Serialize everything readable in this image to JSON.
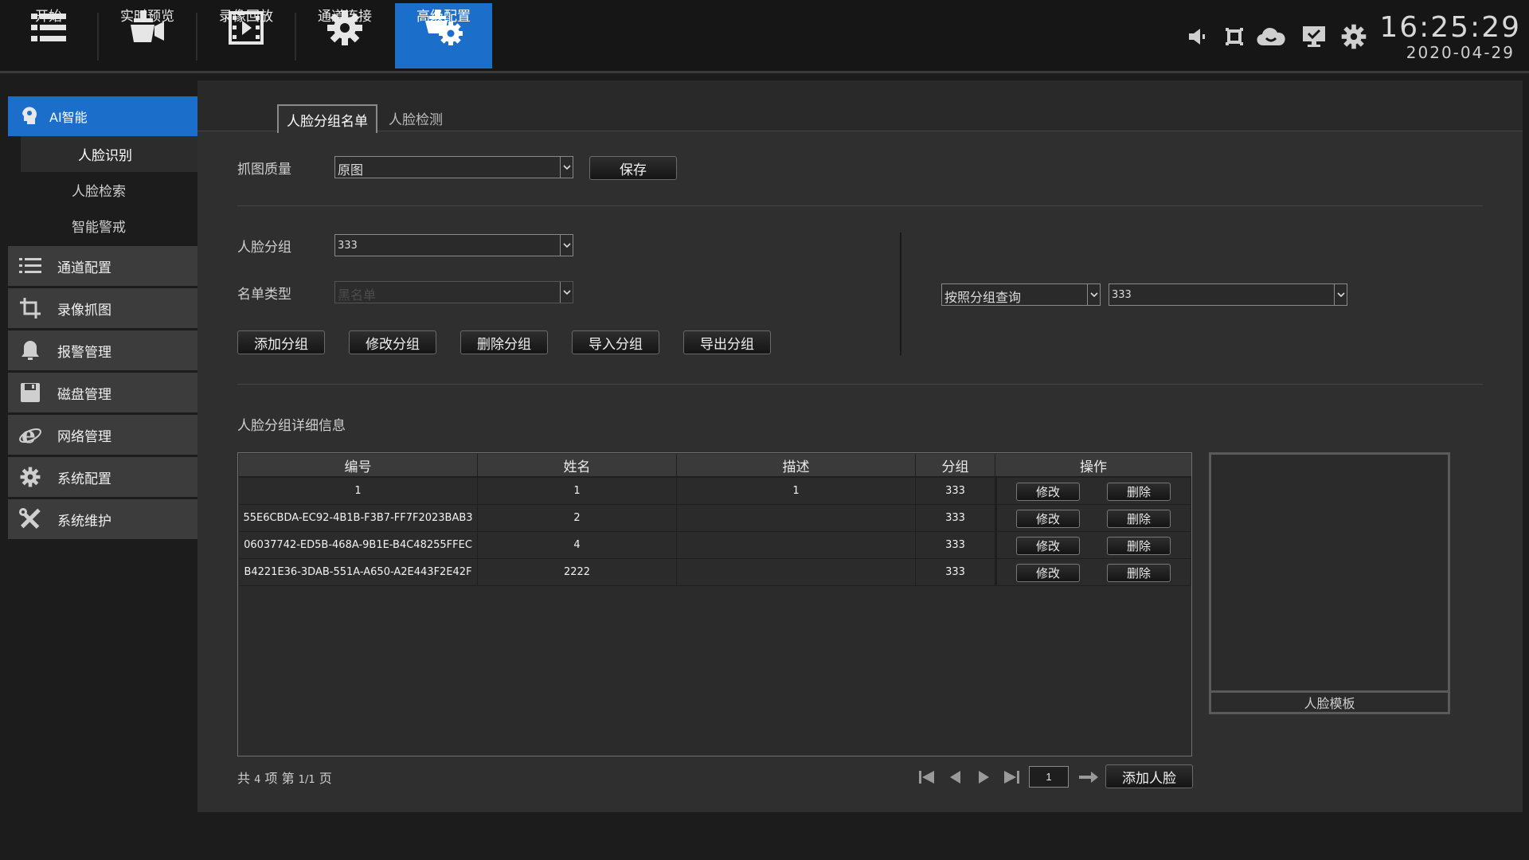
{
  "topnav": {
    "items": [
      {
        "label": "开始",
        "icon": "menu-list-icon"
      },
      {
        "label": "实时预览",
        "icon": "live-camera-icon"
      },
      {
        "label": "录像回放",
        "icon": "film-playback-icon"
      },
      {
        "label": "通道连接",
        "icon": "gear-icon"
      },
      {
        "label": "高级配置",
        "icon": "advanced-config-icon"
      }
    ],
    "active_index": 4,
    "status_icons": [
      "speaker-icon",
      "record-icon",
      "cloud-icon",
      "monitor-icon",
      "settings-icon"
    ],
    "time": "16:25:29",
    "date": "2020-04-29"
  },
  "sidebar": {
    "header": {
      "label": "AI智能",
      "icon": "ai-head-icon"
    },
    "subitems": [
      "人脸识别",
      "人脸检索",
      "智能警戒"
    ],
    "active_sub": 0,
    "items": [
      {
        "label": "通道配置",
        "icon": "list-icon"
      },
      {
        "label": "录像抓图",
        "icon": "crop-icon"
      },
      {
        "label": "报警管理",
        "icon": "bell-icon"
      },
      {
        "label": "磁盘管理",
        "icon": "floppy-disk-icon"
      },
      {
        "label": "网络管理",
        "icon": "ie-globe-icon"
      },
      {
        "label": "系统配置",
        "icon": "gear-icon"
      },
      {
        "label": "系统维护",
        "icon": "tools-icon"
      }
    ]
  },
  "tabs": [
    "人脸分组名单",
    "人脸检测"
  ],
  "form": {
    "capture_quality_label": "抓图质量",
    "capture_quality_value": "原图",
    "save_label": "保存",
    "face_group_label": "人脸分组",
    "face_group_value": "333",
    "list_type_label": "名单类型",
    "list_type_value": "黑名单",
    "buttons": [
      "添加分组",
      "修改分组",
      "删除分组",
      "导入分组",
      "导出分组"
    ],
    "query_mode_value": "按照分组查询",
    "query_group_value": "333"
  },
  "detail": {
    "section_title": "人脸分组详细信息",
    "columns": [
      "编号",
      "姓名",
      "描述",
      "分组",
      "操作"
    ],
    "rows": [
      {
        "id": "1",
        "name": "1",
        "desc": "1",
        "group": "333"
      },
      {
        "id": "55E6CBDA-EC92-4B1B-F3B7-FF7F2023BAB3",
        "name": "2",
        "desc": "",
        "group": "333"
      },
      {
        "id": "06037742-ED5B-468A-9B1E-B4C48255FFEC",
        "name": "4",
        "desc": "",
        "group": "333"
      },
      {
        "id": "B4221E36-3DAB-551A-A650-A2E443F2E42F",
        "name": "2222",
        "desc": "",
        "group": "333"
      }
    ],
    "edit_label": "修改",
    "delete_label": "删除",
    "template_caption": "人脸模板"
  },
  "pagination": {
    "total_prefix": "共",
    "total_count": "4",
    "total_suffix": "项  第",
    "page_fraction": "1/1",
    "page_suffix": "页",
    "page_input": "1",
    "add_face_label": "添加人脸"
  },
  "colors": {
    "accent": "#1b6ec9",
    "panel": "#2f2f2f",
    "background": "#1c1c1c"
  }
}
